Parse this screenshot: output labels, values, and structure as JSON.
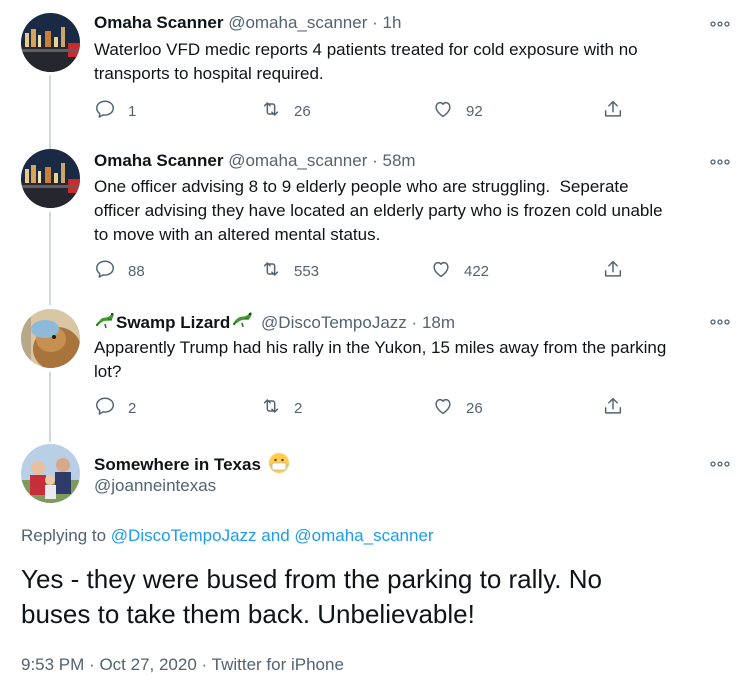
{
  "tweets": [
    {
      "name": "Omaha Scanner",
      "handle": "@omaha_scanner",
      "time": "1h",
      "text_lines": [
        "Waterloo VFD medic reports 4 patients treated for cold exposure with no",
        "transports to hospital required."
      ],
      "replies": "1",
      "retweets": "26",
      "likes": "92"
    },
    {
      "name": "Omaha Scanner",
      "handle": "@omaha_scanner",
      "time": "58m",
      "text_lines": [
        "One officer advising 8 to 9 elderly people who are struggling.  Seperate",
        "officer advising they have located an elderly party who is frozen cold unable",
        "to move with an altered mental status."
      ],
      "replies": "88",
      "retweets": "553",
      "likes": "422"
    },
    {
      "name": "Swamp Lizard",
      "handle": "@DiscoTempoJazz",
      "time": "18m",
      "text_lines": [
        "Apparently Trump had his rally in the Yukon, 15 miles away from the parking",
        "lot?"
      ],
      "replies": "2",
      "retweets": "2",
      "likes": "26"
    }
  ],
  "focus": {
    "name": "Somewhere in Texas",
    "handle": "@joanneintexas",
    "replying_prefix": "Replying to",
    "replying_user1": "@DiscoTempoJazz",
    "replying_and": "and",
    "replying_user2": "@omaha_scanner",
    "text_lines": [
      "Yes - they were bused from the parking to rally. No",
      "buses to take them back. Unbelievable!"
    ],
    "time": "9:53 PM",
    "date": "Oct 27, 2020",
    "source": "Twitter for iPhone"
  },
  "icons": {
    "reply": "reply-icon",
    "retweet": "retweet-icon",
    "like": "heart-icon",
    "share": "share-icon",
    "more": "more-icon",
    "lizard": "lizard-emoji",
    "mask": "mask-emoji"
  },
  "colors": {
    "text": "#0f1419",
    "secondary": "#536471",
    "link": "#1d9bf0",
    "thread_line": "#cfd9de"
  }
}
